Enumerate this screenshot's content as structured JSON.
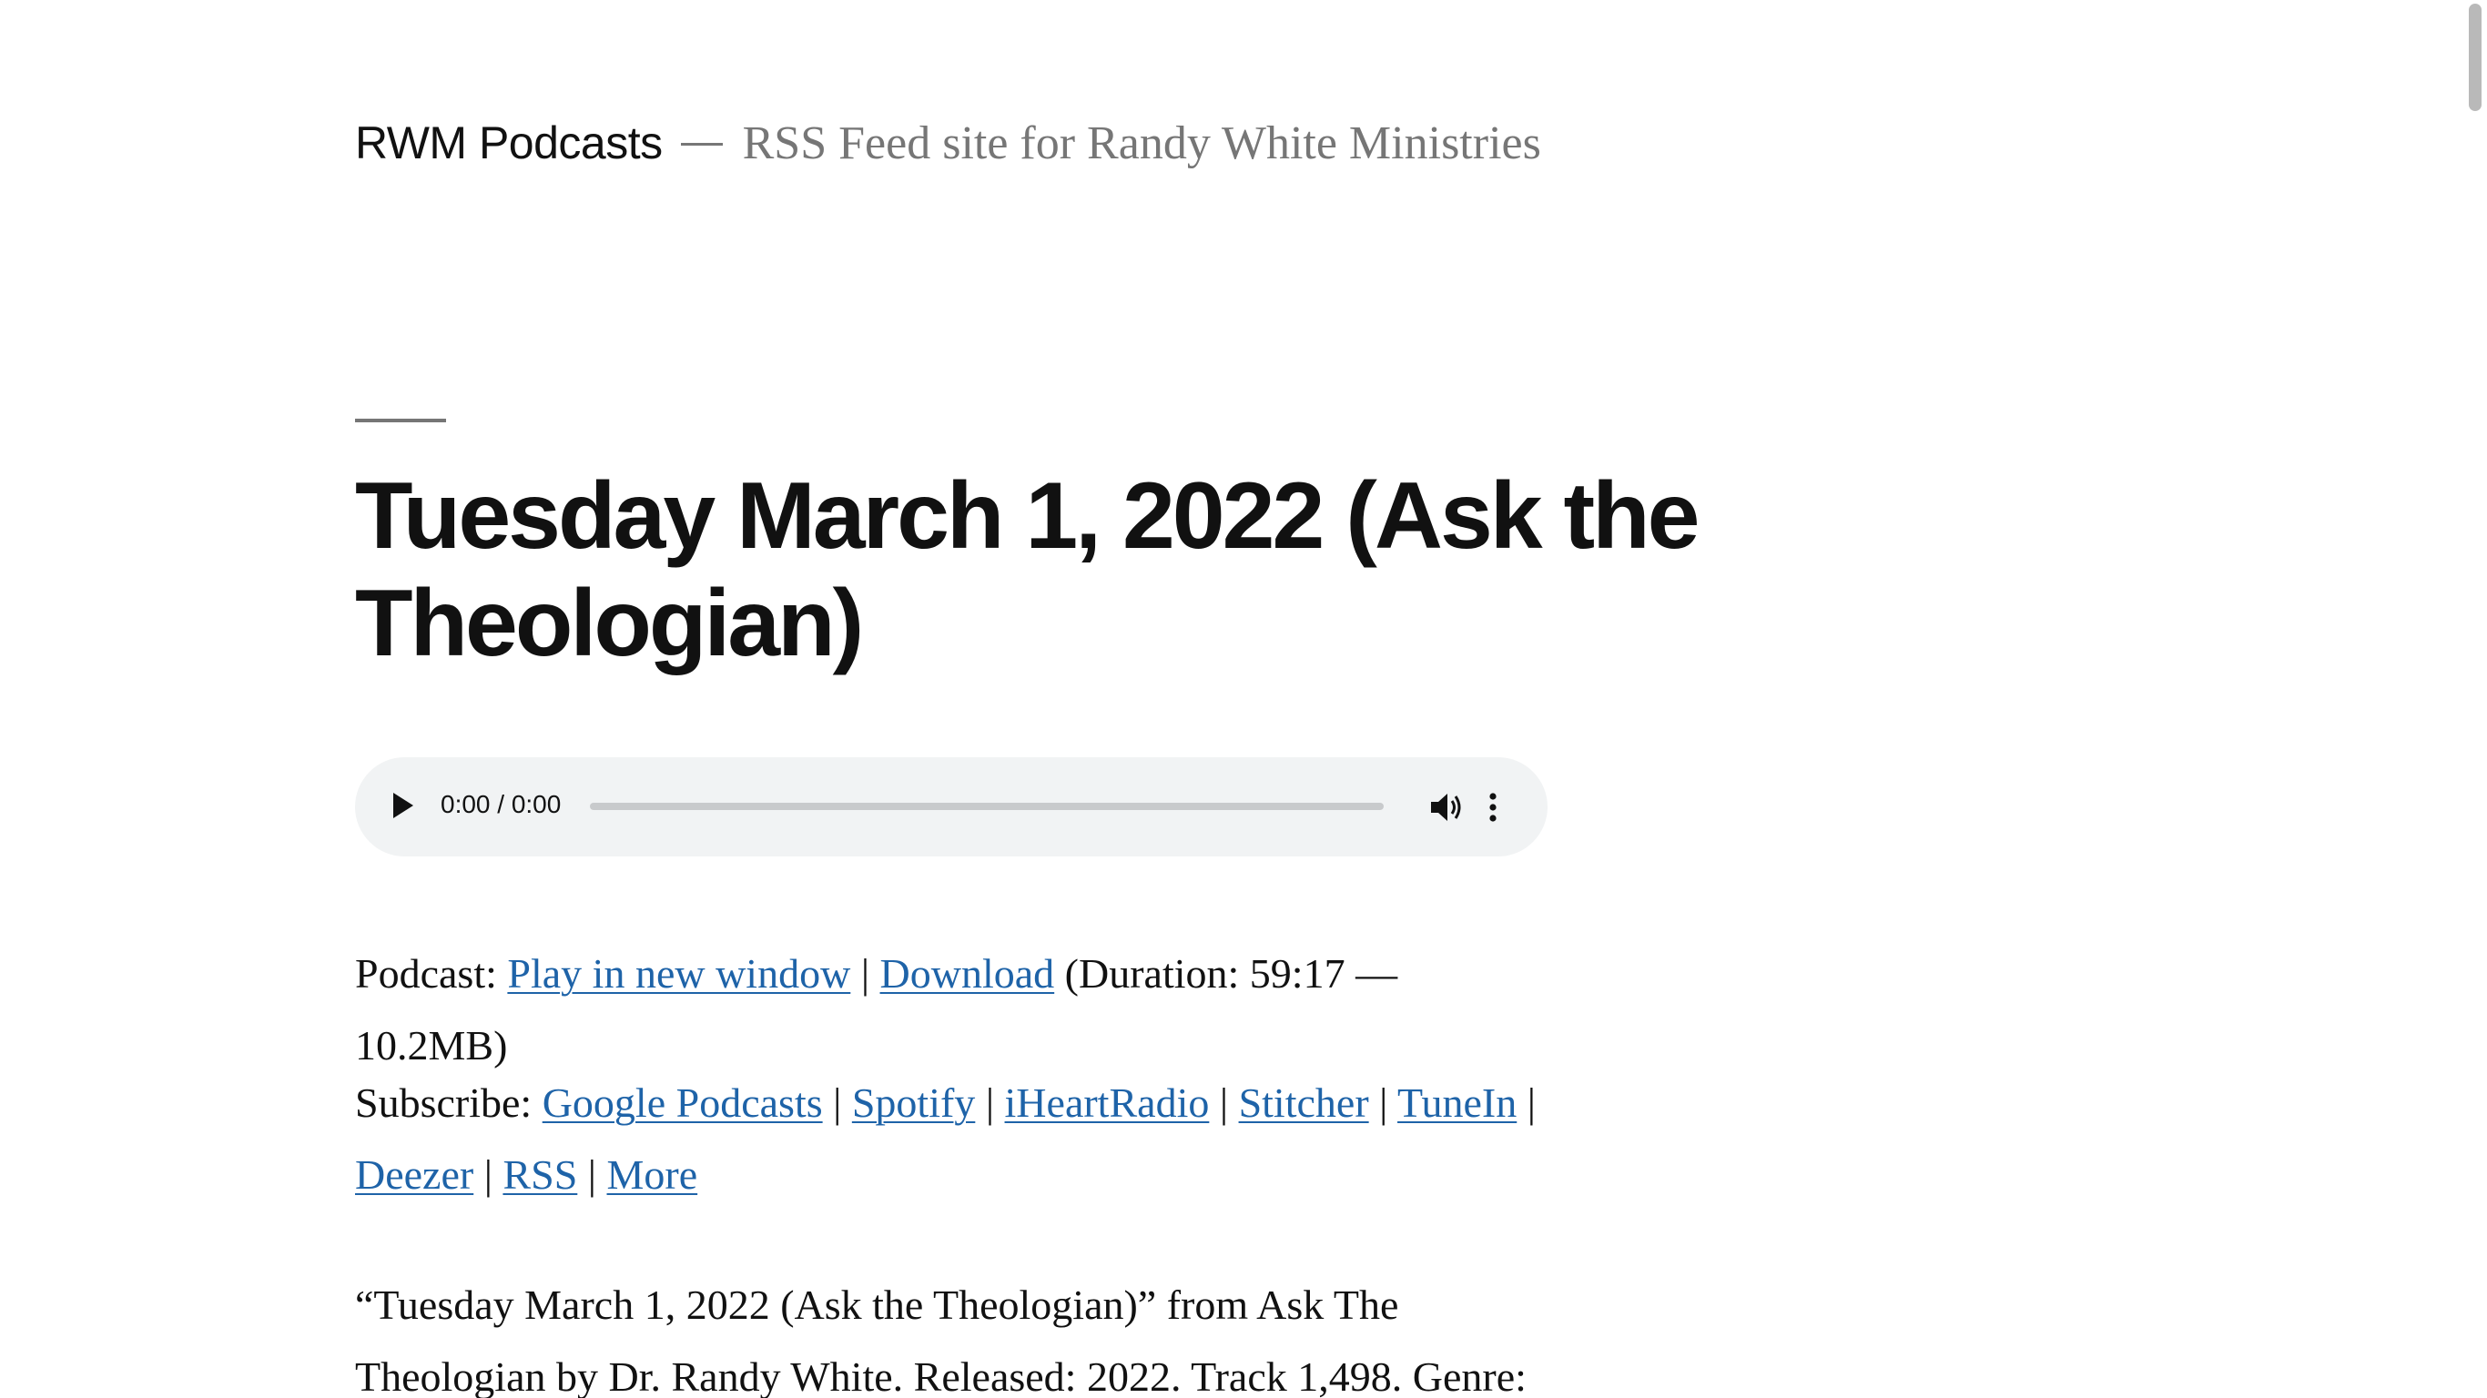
{
  "header": {
    "site_title": "RWM Podcasts",
    "site_description": "RSS Feed site for Randy White Ministries"
  },
  "post": {
    "title": "Tuesday March 1, 2022 (Ask the Theologian)"
  },
  "player": {
    "time": "0:00 / 0:00",
    "icons": [
      "play-icon",
      "volume-icon",
      "more-vert-icon"
    ]
  },
  "podcast_line": {
    "label": "Podcast:",
    "play_new_window": "Play in new window",
    "sep": "|",
    "download": "Download",
    "duration": "(Duration: 59:17 — 10.2MB)"
  },
  "subscribe": {
    "label": "Subscribe:",
    "links": [
      "Google Podcasts",
      "Spotify",
      "iHeartRadio",
      "Stitcher",
      "TuneIn",
      "Deezer",
      "RSS",
      "More"
    ],
    "sep": "|"
  },
  "description": {
    "text": "“Tuesday March 1, 2022 (Ask the Theologian)” from Ask The Theologian by Dr. Randy White. Released: 2022. Track 1,498. Genre:"
  },
  "colors": {
    "link": "#1e63a8",
    "muted": "#767676",
    "player_bg": "#f1f3f4"
  }
}
